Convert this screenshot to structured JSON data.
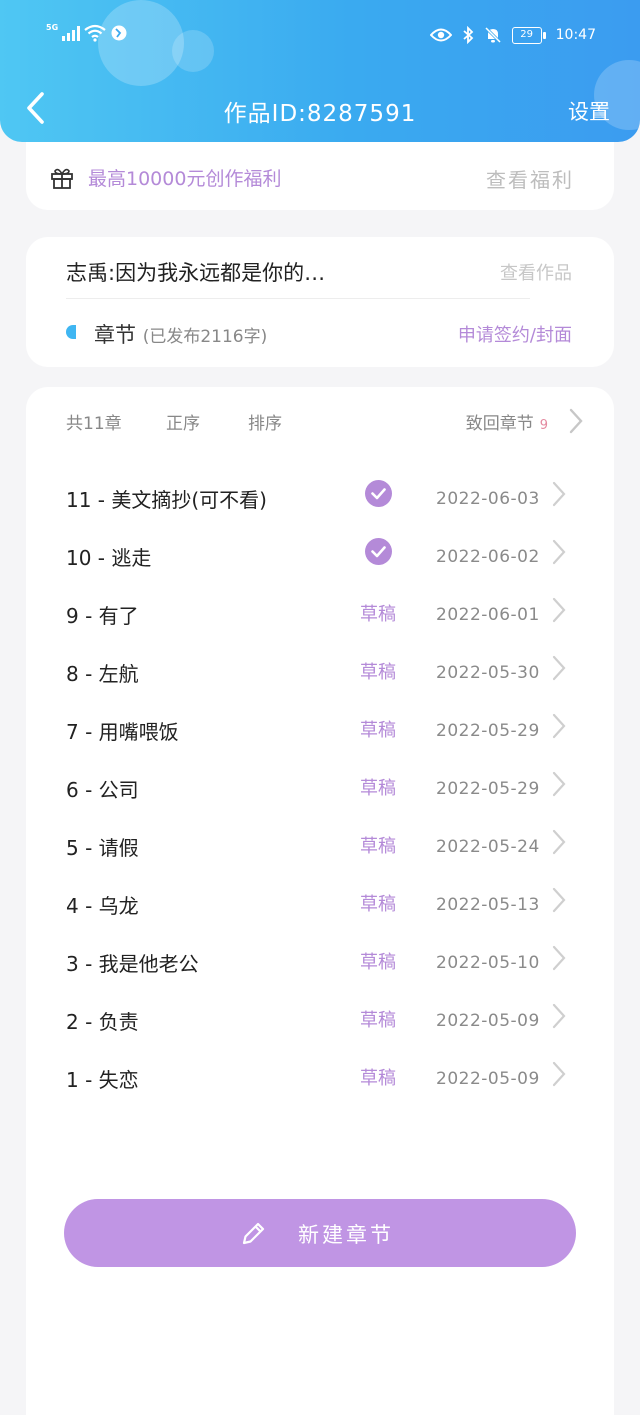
{
  "status_bar": {
    "network": "5G",
    "time": "10:47",
    "battery": "29"
  },
  "header": {
    "title": "作品ID:8287591",
    "settings_label": "设置"
  },
  "benefit": {
    "text": "最高10000元创作福利",
    "link": "查看福利"
  },
  "work": {
    "title": "志禹:因为我永远都是你的…",
    "view_link": "查看作品",
    "chapters_label": "章节",
    "chapters_sub": "(已发布2116字)",
    "sign_link": "申请签约/封面"
  },
  "toolbar": {
    "count": "共11章",
    "order": "正序",
    "sort": "排序",
    "recycle": "致回章节",
    "recycle_count": "9"
  },
  "chapters": [
    {
      "title": "11 - 美文摘抄(可不看)",
      "status": "published",
      "status_label": "",
      "date": "2022-06-03"
    },
    {
      "title": "10 - 逃走",
      "status": "published",
      "status_label": "",
      "date": "2022-06-02"
    },
    {
      "title": "9 - 有了",
      "status": "draft",
      "status_label": "草稿",
      "date": "2022-06-01"
    },
    {
      "title": "8 - 左航",
      "status": "draft",
      "status_label": "草稿",
      "date": "2022-05-30"
    },
    {
      "title": "7 - 用嘴喂饭",
      "status": "draft",
      "status_label": "草稿",
      "date": "2022-05-29"
    },
    {
      "title": "6 - 公司",
      "status": "draft",
      "status_label": "草稿",
      "date": "2022-05-29"
    },
    {
      "title": "5 - 请假",
      "status": "draft",
      "status_label": "草稿",
      "date": "2022-05-24"
    },
    {
      "title": "4 - 乌龙",
      "status": "draft",
      "status_label": "草稿",
      "date": "2022-05-13"
    },
    {
      "title": "3 - 我是他老公",
      "status": "draft",
      "status_label": "草稿",
      "date": "2022-05-10"
    },
    {
      "title": "2 - 负责",
      "status": "draft",
      "status_label": "草稿",
      "date": "2022-05-09"
    },
    {
      "title": "1 - 失恋",
      "status": "draft",
      "status_label": "草稿",
      "date": "2022-05-09"
    }
  ],
  "new_chapter": {
    "label": "新建章节"
  },
  "colors": {
    "header_start": "#4fc7f3",
    "header_end": "#3b9cf0",
    "accent": "#b48ad8",
    "button": "#c095e4"
  }
}
